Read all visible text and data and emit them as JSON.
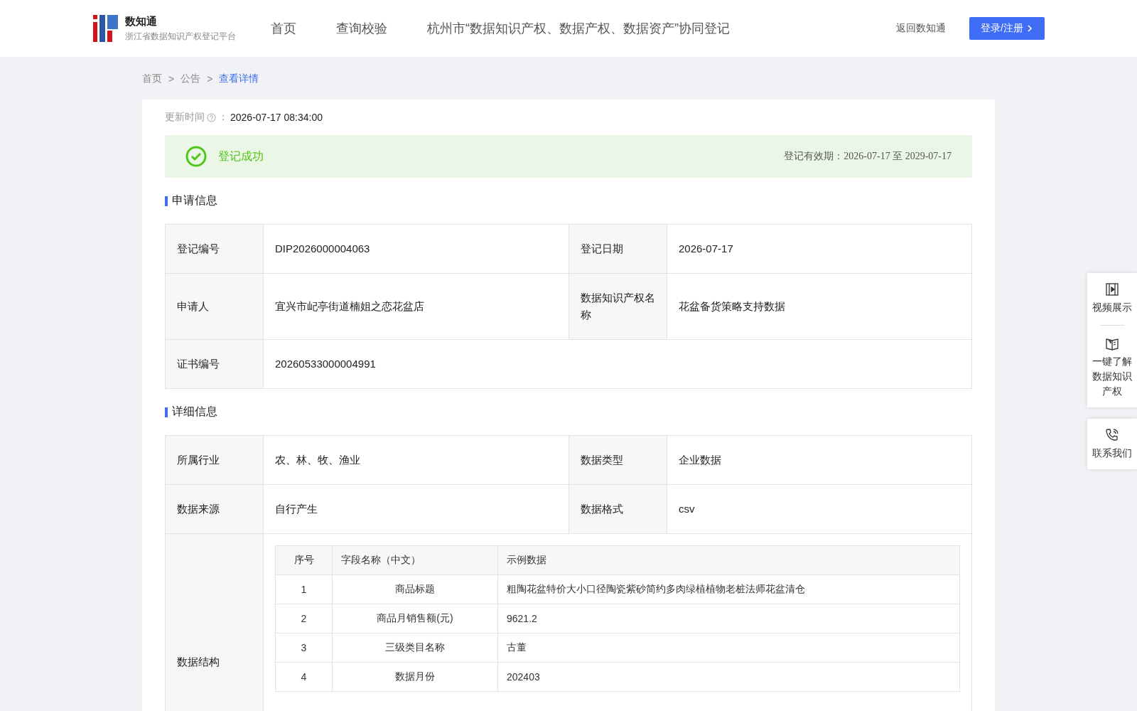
{
  "header": {
    "logo_title": "数知通",
    "logo_subtitle": "浙江省数据知识产权登记平台",
    "nav": [
      {
        "label": "首页",
        "selected": false
      },
      {
        "label": "查询校验",
        "selected": false
      },
      {
        "label": "杭州市“数据知识产权、数据产权、数据资产”协同登记",
        "selected": false
      }
    ],
    "back_link": "返回数知通",
    "login_button": "登录/注册"
  },
  "breadcrumb": [
    {
      "label": "首页",
      "selected": false
    },
    {
      "label": "公告",
      "selected": false
    },
    {
      "label": "查看详情",
      "selected": true
    }
  ],
  "breadcrumb_separator": ">",
  "update": {
    "label": "更新时间",
    "colon": "：",
    "value": "2026-07-17 08:34:00"
  },
  "status": {
    "text": "登记成功",
    "validity": "登记有效期：2026-07-17 至 2029-07-17"
  },
  "sections": [
    {
      "title": "申请信息",
      "rows": [
        [
          {
            "label": "登记编号",
            "value": "DIP2026000004063"
          },
          {
            "label": "登记日期",
            "value": "2026-07-17"
          }
        ],
        [
          {
            "label": "申请人",
            "value": "宜兴市屺亭街道楠姐之恋花盆店"
          },
          {
            "label": "数据知识产权名称",
            "value": "花盆备货策略支持数据"
          }
        ],
        [
          {
            "label": "证书编号",
            "value": "20260533000004991"
          }
        ]
      ]
    },
    {
      "title": "详细信息",
      "rows": [
        [
          {
            "label": "所属行业",
            "value": "农、林、牧、渔业"
          },
          {
            "label": "数据类型",
            "value": "企业数据"
          }
        ],
        [
          {
            "label": "数据来源",
            "value": "自行产生"
          },
          {
            "label": "数据格式",
            "value": "csv"
          }
        ]
      ],
      "structure": {
        "label": "数据结构",
        "columns": [
          "序号",
          "字段名称（中文）",
          "示例数据"
        ],
        "rows": [
          [
            "1",
            "商品标题",
            "粗陶花盆特价大小口径陶瓷紫砂简约多肉绿植植物老桩法师花盆清仓"
          ],
          [
            "2",
            "商品月销售额(元)",
            "9621.2"
          ],
          [
            "3",
            "三级类目名称",
            "古董"
          ],
          [
            "4",
            "数据月份",
            "202403"
          ]
        ]
      }
    }
  ],
  "side_panel": [
    {
      "kind": "video",
      "label": "视频展示"
    },
    {
      "kind": "book",
      "label": "一键了解数据知识产权"
    },
    {
      "kind": "phone",
      "label": "联系我们"
    }
  ]
}
